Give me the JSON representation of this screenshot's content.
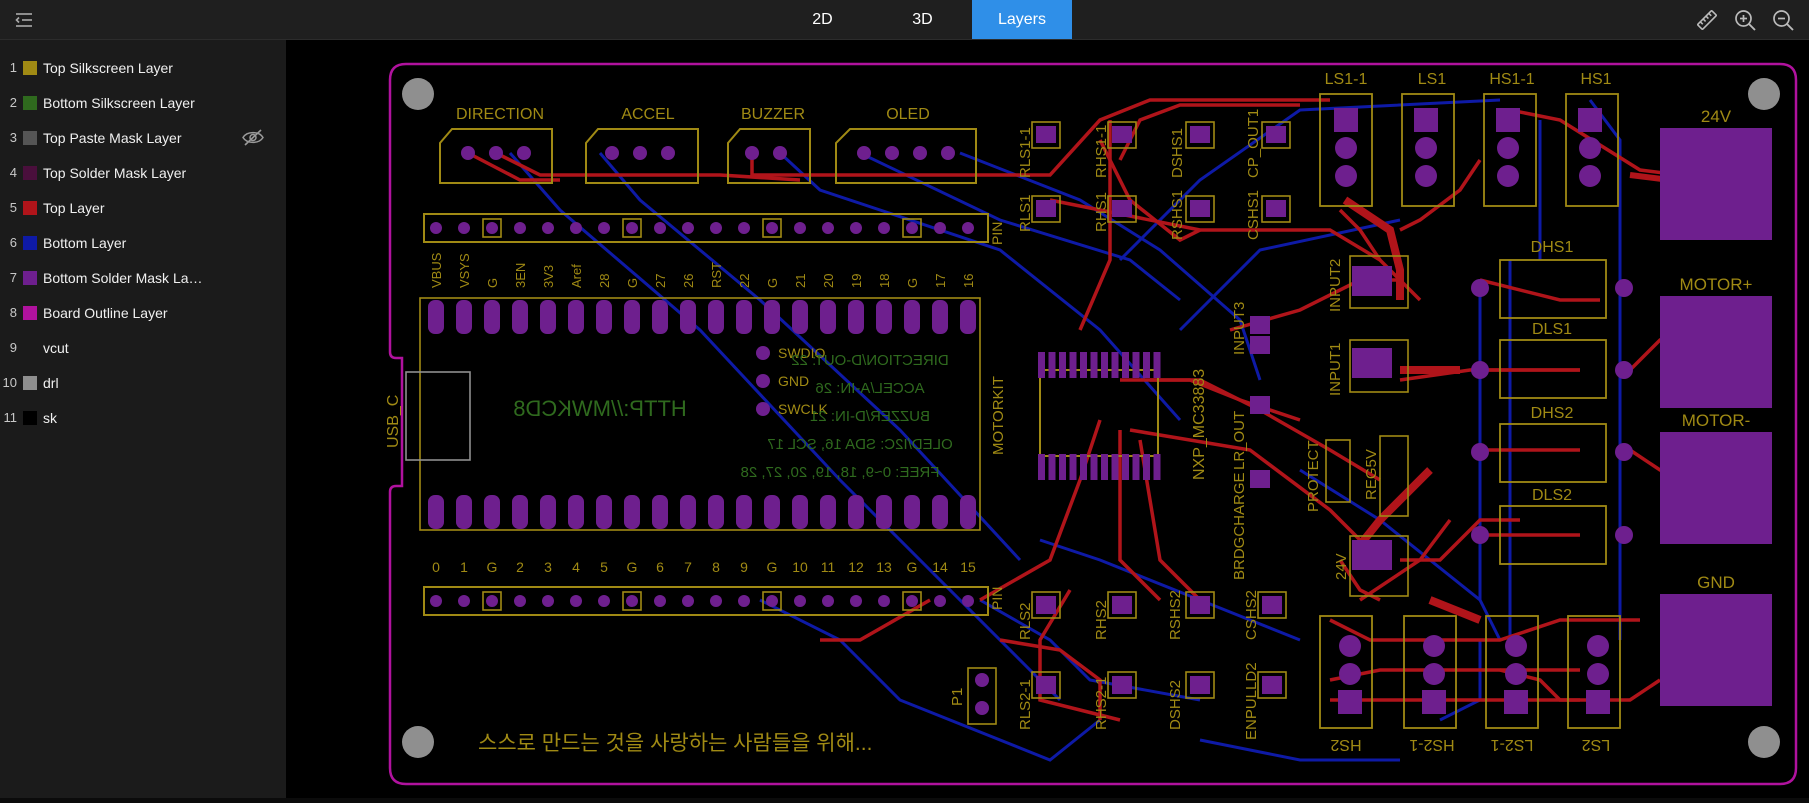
{
  "toolbar": {
    "tabs": [
      {
        "label": "2D"
      },
      {
        "label": "3D"
      },
      {
        "label": "Layers"
      }
    ],
    "active_tab": "Layers",
    "accent_color": "#2f8fe8"
  },
  "layers": [
    {
      "num": "1",
      "name": "Top Silkscreen Layer",
      "color": "#a08a14"
    },
    {
      "num": "2",
      "name": "Bottom Silkscreen Layer",
      "color": "#2f6a1e"
    },
    {
      "num": "3",
      "name": "Top Paste Mask Layer",
      "color": "#555555",
      "hidden": true
    },
    {
      "num": "4",
      "name": "Top Solder Mask Layer",
      "color": "#4a0f3c"
    },
    {
      "num": "5",
      "name": "Top Layer",
      "color": "#b0141a"
    },
    {
      "num": "6",
      "name": "Bottom Layer",
      "color": "#0e1aa6"
    },
    {
      "num": "7",
      "name": "Bottom Solder Mask La…",
      "color": "#6e1f8e"
    },
    {
      "num": "8",
      "name": "Board Outline Layer",
      "color": "#b0129e"
    },
    {
      "num": "9",
      "name": "vcut",
      "color": "#1b1b1b"
    },
    {
      "num": "10",
      "name": "drl",
      "color": "#8f8f8f"
    },
    {
      "num": "11",
      "name": "sk",
      "color": "#000000"
    }
  ],
  "board": {
    "connectors": [
      "DIRECTION",
      "ACCEL",
      "BUZZER",
      "OLED"
    ],
    "top_pin_labels": [
      "VBUS",
      "VSYS",
      "G",
      "3EN",
      "3V3",
      "Aref",
      "28",
      "G",
      "27",
      "26",
      "RST",
      "22",
      "G",
      "21",
      "20",
      "19",
      "18",
      "G",
      "17",
      "16"
    ],
    "bottom_pin_labels": [
      "0",
      "1",
      "G",
      "2",
      "3",
      "4",
      "5",
      "G",
      "6",
      "7",
      "8",
      "9",
      "G",
      "10",
      "11",
      "12",
      "13",
      "G",
      "14",
      "15"
    ],
    "pin_label": "PIN",
    "usb_label": "USB_C",
    "url_text": "HTTP://MWKCD8",
    "debug_pins": [
      "SWDIO",
      "GND",
      "SWCLK"
    ],
    "config_text": [
      "DIRECTION/D-OUT: 22",
      "ACCEL/A-IN: 26",
      "BUZZER/D-IN: 21",
      "OLED/I2C: SDA 16, SCL 17",
      "FREE: 0~9, 18, 19, 20, 27, 28"
    ],
    "motorkit_label": "MOTORKIT",
    "chip_label": "NXP_MC33883",
    "top_parts": [
      "RLS1-1",
      "RLS1",
      "RHS1-1",
      "RHS1",
      "DSHS1",
      "RSHS1",
      "CSHS1",
      "CP_OUT1"
    ],
    "mid_parts": [
      "INPUT2",
      "INPUT3",
      "INPUT1",
      "LR_OUT",
      "BRDGCHARGE",
      "PROTECT",
      "REG5V",
      "24V"
    ],
    "bottom_parts": [
      "RLS2",
      "RLS2-1",
      "RHS2",
      "RHS2-1",
      "RSHS2",
      "DSHS2",
      "ENPULLD2",
      "CSHS2",
      "P1"
    ],
    "headers_top": [
      "LS1-1",
      "LS1",
      "HS1-1",
      "HS1"
    ],
    "headers_bottom": [
      "HS2",
      "HS2-1",
      "LS2-1",
      "LS2"
    ],
    "fets": [
      "DHS1",
      "DLS1",
      "DHS2",
      "DLS2"
    ],
    "pads_right": [
      "24V",
      "MOTOR+",
      "MOTOR-",
      "GND"
    ],
    "slogan": "스스로 만드는 것을 사랑하는 사람들을 위해..."
  }
}
